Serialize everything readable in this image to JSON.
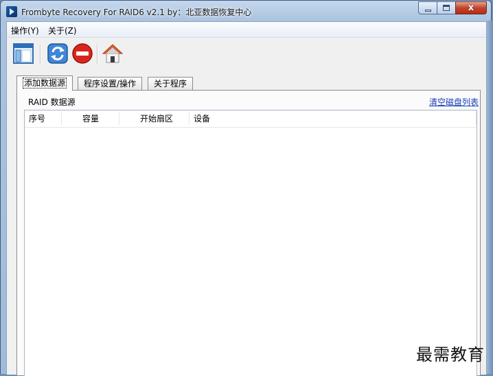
{
  "window": {
    "title": "Frombyte Recovery For RAID6 v2.1 by：北亚数据恢复中心",
    "close_glyph": "x"
  },
  "menu": {
    "items": [
      "操作(Y)",
      "关于(Z)"
    ]
  },
  "toolbar": {
    "buttons": [
      "panel-icon",
      "refresh-icon",
      "stop-icon",
      "home-icon"
    ]
  },
  "tabs": [
    "添加数据源",
    "程序设置/操作",
    "关于程序"
  ],
  "active_tab": 0,
  "panel": {
    "group_label": "RAID 数据源",
    "clear_link": "清空磁盘列表"
  },
  "list": {
    "columns": [
      "序号",
      "容量",
      "开始扇区",
      "设备"
    ],
    "rows": []
  },
  "watermark": "最需教育",
  "colors": {
    "accent": "#1a3fb8",
    "stop_red": "#d9261c",
    "home_orange": "#e0642a"
  }
}
